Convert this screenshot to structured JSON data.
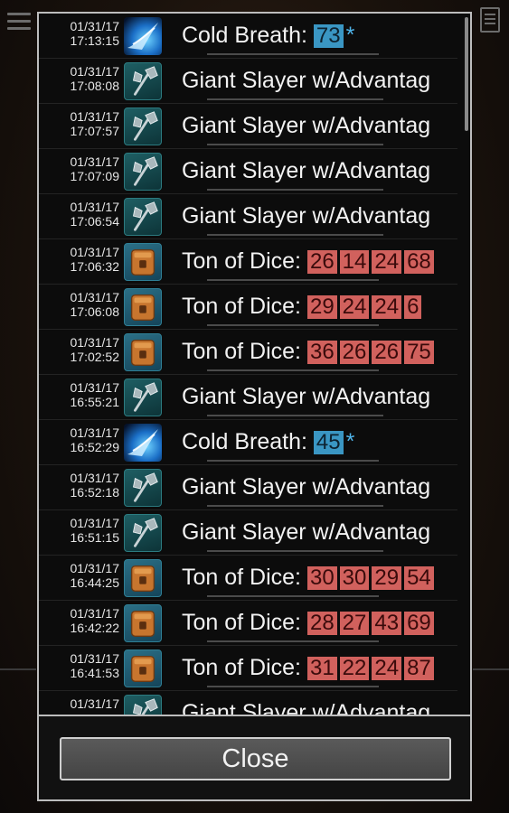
{
  "dialog": {
    "rows": [
      {
        "date": "01/31/17",
        "time": "17:13:15",
        "icon": "cold-breath-icon",
        "name": "Cold Breath:",
        "values": [
          "73"
        ],
        "value_style": "blue",
        "suffix": "*"
      },
      {
        "date": "01/31/17",
        "time": "17:08:08",
        "icon": "axe-icon",
        "name": "Giant Slayer w/Advantag",
        "values": [],
        "value_style": "",
        "suffix": ""
      },
      {
        "date": "01/31/17",
        "time": "17:07:57",
        "icon": "axe-icon",
        "name": "Giant Slayer w/Advantag",
        "values": [],
        "value_style": "",
        "suffix": ""
      },
      {
        "date": "01/31/17",
        "time": "17:07:09",
        "icon": "axe-icon",
        "name": "Giant Slayer w/Advantag",
        "values": [],
        "value_style": "",
        "suffix": ""
      },
      {
        "date": "01/31/17",
        "time": "17:06:54",
        "icon": "axe-icon",
        "name": "Giant Slayer w/Advantag",
        "values": [],
        "value_style": "",
        "suffix": ""
      },
      {
        "date": "01/31/17",
        "time": "17:06:32",
        "icon": "dice-bag-icon",
        "name": "Ton of Dice:",
        "values": [
          "26",
          "14",
          "24",
          "68"
        ],
        "value_style": "red",
        "suffix": ""
      },
      {
        "date": "01/31/17",
        "time": "17:06:08",
        "icon": "dice-bag-icon",
        "name": "Ton of Dice:",
        "values": [
          "29",
          "24",
          "24",
          "6"
        ],
        "value_style": "red",
        "suffix": ""
      },
      {
        "date": "01/31/17",
        "time": "17:02:52",
        "icon": "dice-bag-icon",
        "name": "Ton of Dice:",
        "values": [
          "36",
          "26",
          "26",
          "75"
        ],
        "value_style": "red",
        "suffix": ""
      },
      {
        "date": "01/31/17",
        "time": "16:55:21",
        "icon": "axe-icon",
        "name": "Giant Slayer w/Advantag",
        "values": [],
        "value_style": "",
        "suffix": ""
      },
      {
        "date": "01/31/17",
        "time": "16:52:29",
        "icon": "cold-breath-icon",
        "name": "Cold Breath:",
        "values": [
          "45"
        ],
        "value_style": "blue",
        "suffix": "*"
      },
      {
        "date": "01/31/17",
        "time": "16:52:18",
        "icon": "axe-icon",
        "name": "Giant Slayer w/Advantag",
        "values": [],
        "value_style": "",
        "suffix": ""
      },
      {
        "date": "01/31/17",
        "time": "16:51:15",
        "icon": "axe-icon",
        "name": "Giant Slayer w/Advantag",
        "values": [],
        "value_style": "",
        "suffix": ""
      },
      {
        "date": "01/31/17",
        "time": "16:44:25",
        "icon": "dice-bag-icon",
        "name": "Ton of Dice:",
        "values": [
          "30",
          "30",
          "29",
          "54"
        ],
        "value_style": "red",
        "suffix": ""
      },
      {
        "date": "01/31/17",
        "time": "16:42:22",
        "icon": "dice-bag-icon",
        "name": "Ton of Dice:",
        "values": [
          "28",
          "27",
          "43",
          "69"
        ],
        "value_style": "red",
        "suffix": ""
      },
      {
        "date": "01/31/17",
        "time": "16:41:53",
        "icon": "dice-bag-icon",
        "name": "Ton of Dice:",
        "values": [
          "31",
          "22",
          "24",
          "87"
        ],
        "value_style": "red",
        "suffix": ""
      },
      {
        "date": "01/31/17",
        "time": "",
        "icon": "axe-icon",
        "name": "Giant Slayer w/Advantag",
        "values": [],
        "value_style": "",
        "suffix": ""
      }
    ],
    "close_label": "Close"
  },
  "colors": {
    "blue_value": "#3a96c3",
    "red_value": "#d1615d",
    "border": "#bdbdbd"
  }
}
